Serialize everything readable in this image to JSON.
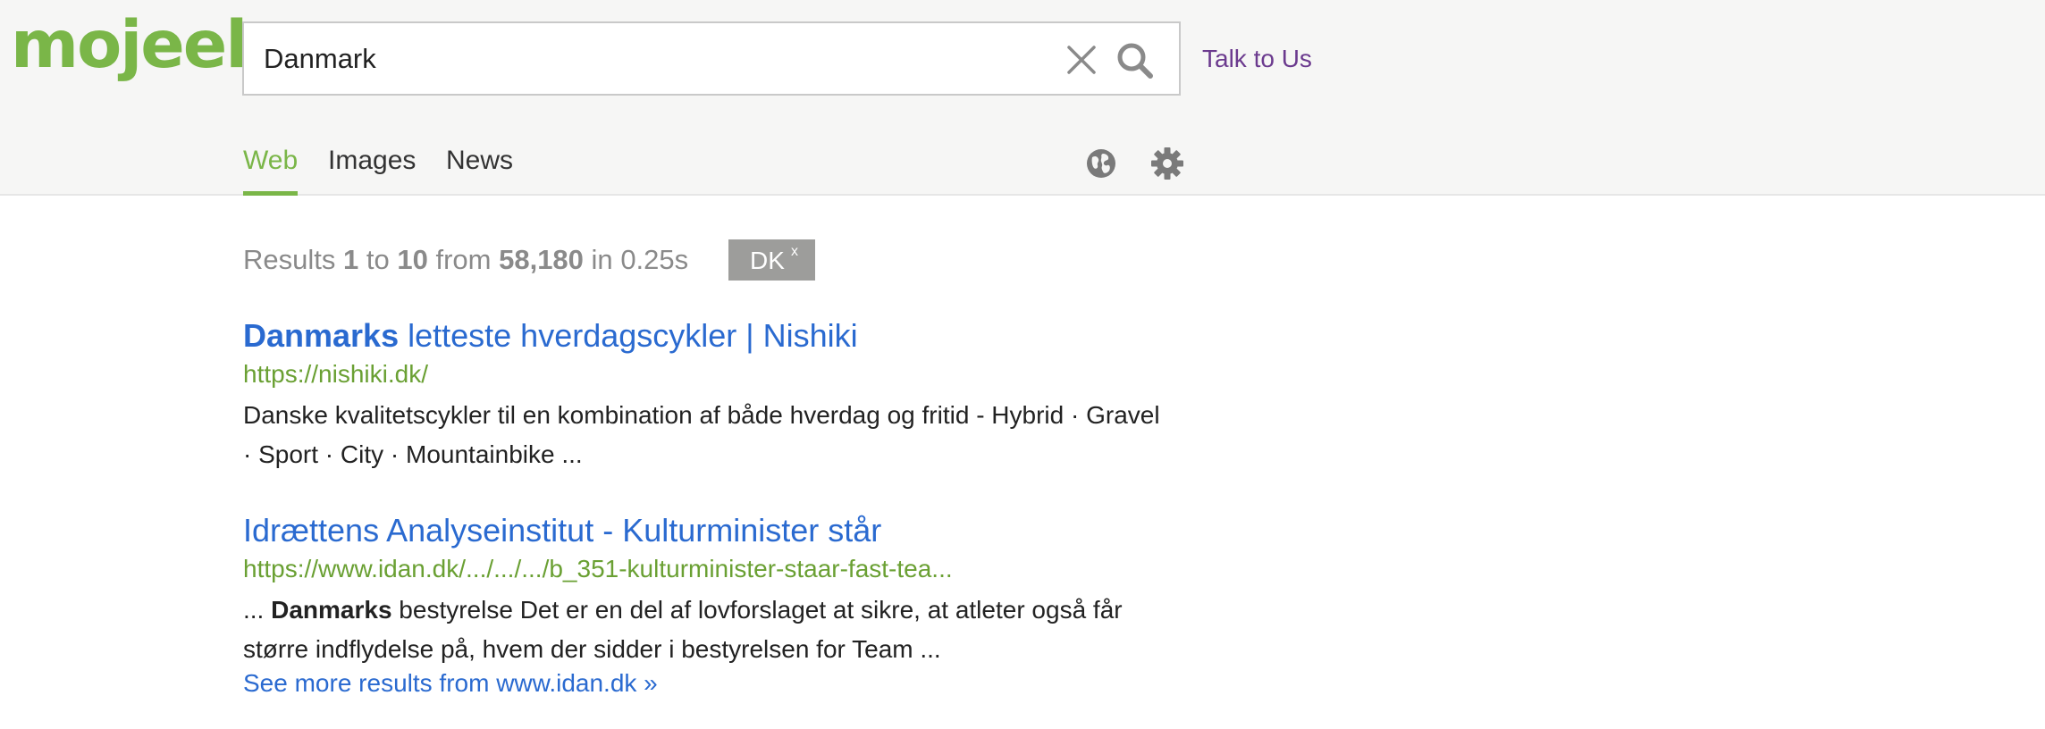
{
  "brand": {
    "logo_text": "mojeek",
    "accent": "#7ab648"
  },
  "search": {
    "value": "Danmark",
    "placeholder": "",
    "clear_icon": "close-icon",
    "submit_icon": "search-icon"
  },
  "header": {
    "talk_link": "Talk to Us"
  },
  "tabs": [
    {
      "label": "Web",
      "active": true
    },
    {
      "label": "Images",
      "active": false
    },
    {
      "label": "News",
      "active": false
    }
  ],
  "toolbar": {
    "region_icon": "globe-icon",
    "settings_icon": "gear-icon"
  },
  "results_info": {
    "prefix": "Results",
    "start": "1",
    "to": "to",
    "end": "10",
    "from": "from",
    "total": "58,180",
    "in": "in",
    "time": "0.25s"
  },
  "region_filter": {
    "label": "DK",
    "remove": "x"
  },
  "results": [
    {
      "title_bold": "Danmarks",
      "title_rest": " letteste hverdagscykler | Nishiki",
      "url": "https://nishiki.dk/",
      "snippet_pre": "",
      "snippet_bold": "",
      "snippet_rest": "Danske kvalitetscykler til en kombination af både hverdag og fritid - Hybrid · Gravel · Sport · City · Mountainbike ..."
    },
    {
      "title_bold": "",
      "title_rest": "Idrættens Analyseinstitut - Kulturminister står",
      "url": "https://www.idan.dk/.../.../.../b_351-kulturminister-staar-fast-tea...",
      "snippet_pre": "... ",
      "snippet_bold": "Danmarks",
      "snippet_rest": " bestyrelse Det er en del af lovforslaget at sikre, at atleter også får større indflydelse på, hvem der sidder i bestyrelsen for Team ...",
      "more": "See more results from www.idan.dk »"
    }
  ]
}
